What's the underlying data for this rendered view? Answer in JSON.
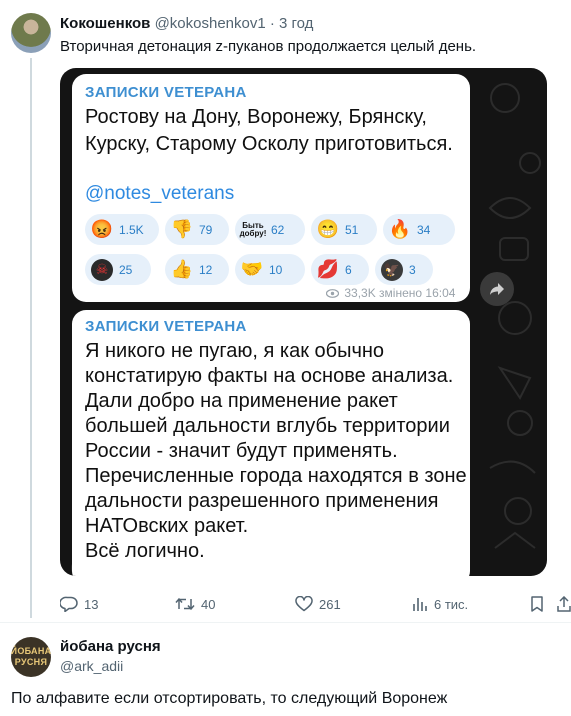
{
  "tweet": {
    "author_name": "Кокошенков",
    "author_handle": "@kokoshenkov1",
    "time": "· 3 год",
    "text": "Вторичная детонация z-пуканов продолжается целый день.",
    "actions": {
      "replies": "13",
      "retweets": "40",
      "likes": "261",
      "views": "6 тис."
    }
  },
  "telegram": {
    "post1": {
      "channel": "ЗАПИСКИ VETEРАНА",
      "lines": [
        "Ростову на Дону, Воронежу, Брянску,",
        "Курску, Старому Осколу приготовиться."
      ],
      "mention": "@notes_veterans",
      "reactions_row1": [
        {
          "icon": "angry-face-icon",
          "glyph": "😡",
          "count": "1.5K"
        },
        {
          "icon": "thumbs-down-icon",
          "glyph": "👎",
          "count": "79"
        },
        {
          "icon": "byt-dobru-sticker-icon",
          "glyph": "Быть добру!",
          "count": "62"
        },
        {
          "icon": "grinning-face-icon",
          "glyph": "😁",
          "count": "51"
        },
        {
          "icon": "fire-icon",
          "glyph": "🔥",
          "count": "34"
        }
      ],
      "reactions_row2": [
        {
          "icon": "skull-emblem-icon",
          "glyph": "☠",
          "count": "25"
        },
        {
          "icon": "thumbs-up-icon",
          "glyph": "👍",
          "count": "12"
        },
        {
          "icon": "handshake-icon",
          "glyph": "🤝",
          "count": "10"
        },
        {
          "icon": "lips-icon",
          "glyph": "💋",
          "count": "6"
        },
        {
          "icon": "eagle-emblem-icon",
          "glyph": "🦅",
          "count": "3"
        }
      ],
      "views": "33,3K",
      "edited": "змінено 16:04"
    },
    "post2": {
      "channel": "ЗАПИСКИ VETEРАНА",
      "lines": [
        "Я никого не пугаю, я как обычно",
        "констатирую факты на основе анализа.",
        "Дали добро на применение ракет",
        "большей дальности вглубь территории",
        "России - значит будут применять.",
        "Перечисленные города находятся в зоне",
        "дальности разрешенного применения",
        "НАТОвских ракет.",
        "Всё логично."
      ]
    }
  },
  "reply": {
    "author_name": "йобана русня",
    "author_handle": "@ark_adii",
    "avatar_text": [
      "ЙОБАНА",
      "РУСНЯ"
    ],
    "text": "По алфавите если отсортировать, то следующий Воронеж"
  },
  "colors": {
    "channel_blue": "#3e8fd1",
    "reaction_bg": "#e6f0fa",
    "tg_background": "#141414",
    "muted": "#536471"
  }
}
